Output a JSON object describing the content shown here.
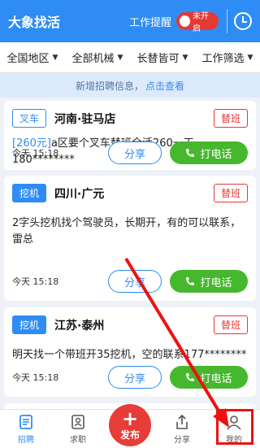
{
  "header": {
    "title": "大象找活",
    "reminder_label": "工作提醒",
    "toggle_text": "未开启"
  },
  "filters": [
    {
      "label": "全国地区"
    },
    {
      "label": "全部机械"
    },
    {
      "label": "长替皆可"
    },
    {
      "label": "工作筛选"
    }
  ],
  "notice": {
    "text": "新增招聘信息，",
    "link": "点击查看"
  },
  "cards": [
    {
      "type": "叉车",
      "location": "河南·驻马店",
      "tag": "替班",
      "price": "[260元]",
      "desc": "a区要个叉车替班全活260一天180********",
      "time": "今天 15:18",
      "share": "分享",
      "call": "打电话"
    },
    {
      "type": "挖机",
      "location": "四川·广元",
      "tag": "替班",
      "desc": "2字头挖机找个驾驶员，长期开，有的可以联系，雷总",
      "time": "今天 15:18",
      "share": "分享",
      "call": "打电话"
    },
    {
      "type": "挖机",
      "location": "江苏·泰州",
      "tag": "替班",
      "desc": "明天找一个带班开35挖机，空的联系177********",
      "time": "今天 15:18",
      "share": "分享",
      "call": "打电话"
    }
  ],
  "tabbar": {
    "recruit": "招聘",
    "job_seek": "求职",
    "publish": "发布",
    "share": "分享",
    "mine": "我的"
  },
  "colors": {
    "primary": "#2f8cf4",
    "green": "#46b82d",
    "red": "#e53935"
  }
}
